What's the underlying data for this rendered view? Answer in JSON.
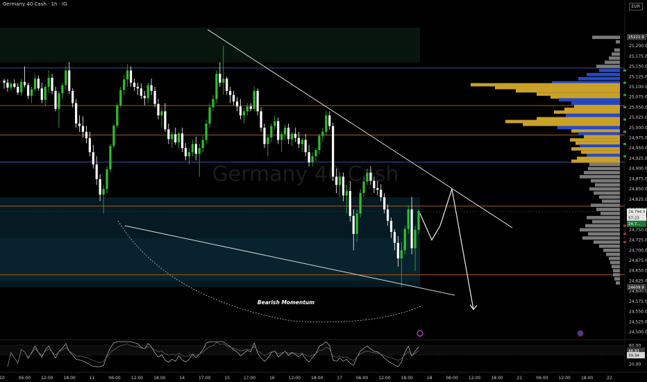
{
  "header": {
    "title": "Germany 40 Cash · 1h · IG",
    "currency": "EUR"
  },
  "watermark": "Germany 40 Cash",
  "annotation": "Bearish Momentum",
  "price_tags": {
    "top": "25221.9",
    "bottom": "24609.9",
    "last": "24,794.5",
    "countdown": "57:23",
    "ema": "24,7..."
  },
  "osc_tags": {
    "upper": "48.93",
    "lower": "39.34"
  },
  "colors": {
    "bg": "#000000",
    "up": "#2fbf2f",
    "down": "#ffffff",
    "line_blue": "#3b4fa8",
    "line_orange": "#a85a1d",
    "vp_gold": "#c9a028",
    "vp_blue": "#2549c8",
    "vp_gray": "#7a7a7a",
    "zone_green": "#0b1e14",
    "zone_teal": "#06202a"
  },
  "chart_data": {
    "type": "candlestick",
    "ylim": [
      24500,
      25275
    ],
    "y_ticks": [
      "25,225.0",
      "25,200.0",
      "25,175.0",
      "25,150.0",
      "25,125.0",
      "25,100.0",
      "25,075.0",
      "25,050.0",
      "25,025.0",
      "25,000.0",
      "24,975.0",
      "24,950.0",
      "24,925.0",
      "24,900.0",
      "24,875.0",
      "24,850.0",
      "24,825.0",
      "24,800.0",
      "24,775.0",
      "24,750.0",
      "24,725.0",
      "24,700.0",
      "24,675.0",
      "24,650.0",
      "24,625.0",
      "24,600.0",
      "24,575.0",
      "24,550.0",
      "24,525.0",
      "24,500.0"
    ],
    "x_ticks": [
      "10",
      "06:00",
      "12:00",
      "18:00",
      "11",
      "06:00",
      "12:00",
      "18:00",
      "14",
      "17:00",
      "15",
      "17:00",
      "16",
      "12:00",
      "18:00",
      "17",
      "06:00",
      "12:00",
      "18:00",
      "18",
      "06:00",
      "12:00",
      "18:00",
      "21",
      "06:00",
      "12:00",
      "18:00",
      "22"
    ],
    "osc_ticks": [
      "60.00",
      "40.00",
      "20.00"
    ],
    "osc_ylim": [
      15,
      68
    ],
    "h_levels": [
      {
        "price": 25146,
        "color": "line_blue"
      },
      {
        "price": 25054,
        "color": "line_orange"
      },
      {
        "price": 24982,
        "color": "line_orange"
      },
      {
        "price": 24916,
        "color": "line_blue"
      },
      {
        "price": 24808,
        "color": "line_orange"
      },
      {
        "price": 24640,
        "color": "line_orange"
      }
    ],
    "candles": [
      [
        25115,
        25120,
        25095,
        25110
      ],
      [
        25110,
        25118,
        25088,
        25098
      ],
      [
        25098,
        25112,
        25090,
        25108
      ],
      [
        25108,
        25118,
        25096,
        25100
      ],
      [
        25100,
        25108,
        25080,
        25086
      ],
      [
        25086,
        25120,
        25078,
        25112
      ],
      [
        25112,
        25150,
        25098,
        25104
      ],
      [
        25104,
        25110,
        25070,
        25078
      ],
      [
        25078,
        25100,
        25060,
        25094
      ],
      [
        25094,
        25130,
        25088,
        25120
      ],
      [
        25120,
        25128,
        25090,
        25096
      ],
      [
        25096,
        25110,
        25060,
        25068
      ],
      [
        25068,
        25105,
        25052,
        25100
      ],
      [
        25100,
        25140,
        25085,
        25122
      ],
      [
        25122,
        25132,
        25082,
        25090
      ],
      [
        25090,
        25100,
        25040,
        25046
      ],
      [
        25046,
        25090,
        25000,
        25084
      ],
      [
        25084,
        25110,
        25070,
        25104
      ],
      [
        25104,
        25150,
        25092,
        25140
      ],
      [
        25140,
        25160,
        25082,
        25090
      ],
      [
        25090,
        25096,
        25050,
        25060
      ],
      [
        25060,
        25070,
        25000,
        25010
      ],
      [
        25010,
        25030,
        24990,
        25004
      ],
      [
        25004,
        25028,
        24975,
        24990
      ],
      [
        24990,
        25004,
        24962,
        24974
      ],
      [
        24974,
        24990,
        24930,
        24940
      ],
      [
        24940,
        24958,
        24900,
        24910
      ],
      [
        24910,
        24930,
        24860,
        24874
      ],
      [
        24874,
        24886,
        24820,
        24836
      ],
      [
        24836,
        24860,
        24790,
        24850
      ],
      [
        24850,
        24905,
        24840,
        24898
      ],
      [
        24898,
        24960,
        24890,
        24955
      ],
      [
        24955,
        25010,
        24950,
        25005
      ],
      [
        25005,
        25060,
        25000,
        25055
      ],
      [
        25055,
        25100,
        25050,
        25092
      ],
      [
        25092,
        25130,
        25080,
        25118
      ],
      [
        25118,
        25155,
        25100,
        25140
      ],
      [
        25140,
        25150,
        25100,
        25110
      ],
      [
        25110,
        25120,
        25090,
        25100
      ],
      [
        25100,
        25110,
        25080,
        25096
      ],
      [
        25096,
        25108,
        25070,
        25078
      ],
      [
        25078,
        25090,
        25055,
        25072
      ],
      [
        25072,
        25110,
        25060,
        25104
      ],
      [
        25104,
        25120,
        25080,
        25090
      ],
      [
        25090,
        25100,
        25050,
        25058
      ],
      [
        25058,
        25070,
        25020,
        25030
      ],
      [
        25030,
        25050,
        25000,
        25040
      ],
      [
        25040,
        25060,
        24990,
        24996
      ],
      [
        24996,
        25010,
        24960,
        24972
      ],
      [
        24972,
        24990,
        24950,
        24984
      ],
      [
        24984,
        25000,
        24958,
        24964
      ],
      [
        24964,
        24990,
        24950,
        24986
      ],
      [
        24986,
        25000,
        24940,
        24950
      ],
      [
        24950,
        24962,
        24920,
        24930
      ],
      [
        24930,
        24950,
        24910,
        24940
      ],
      [
        24940,
        24970,
        24930,
        24960
      ],
      [
        24960,
        24978,
        24920,
        24936
      ],
      [
        24936,
        24960,
        24880,
        24950
      ],
      [
        24950,
        24980,
        24940,
        24970
      ],
      [
        24970,
        25020,
        24960,
        25010
      ],
      [
        25010,
        25060,
        25000,
        25050
      ],
      [
        25050,
        25080,
        25040,
        25070
      ],
      [
        25070,
        25140,
        25060,
        25132
      ],
      [
        25132,
        25160,
        25100,
        25110
      ],
      [
        25110,
        25200,
        25080,
        25120
      ],
      [
        25120,
        25125,
        25080,
        25090
      ],
      [
        25090,
        25100,
        25060,
        25080
      ],
      [
        25080,
        25090,
        25055,
        25064
      ],
      [
        25064,
        25075,
        25040,
        25052
      ],
      [
        25052,
        25070,
        25020,
        25030
      ],
      [
        25030,
        25048,
        25010,
        25040
      ],
      [
        25040,
        25060,
        25030,
        25052
      ],
      [
        25052,
        25060,
        25040,
        25046
      ],
      [
        25046,
        25100,
        25040,
        25090
      ],
      [
        25090,
        25096,
        25030,
        25040
      ],
      [
        25040,
        25050,
        24990,
        25000
      ],
      [
        25000,
        25010,
        24950,
        24960
      ],
      [
        24960,
        24980,
        24930,
        24976
      ],
      [
        24976,
        25010,
        24965,
        25004
      ],
      [
        25004,
        25030,
        24995,
        25016
      ],
      [
        25016,
        25025,
        24960,
        24970
      ],
      [
        24970,
        24990,
        24940,
        24984
      ],
      [
        24984,
        25008,
        24970,
        25000
      ],
      [
        25000,
        25010,
        24960,
        24972
      ],
      [
        24972,
        24990,
        24955,
        24985
      ],
      [
        24985,
        25000,
        24965,
        24975
      ],
      [
        24975,
        24990,
        24950,
        24960
      ],
      [
        24960,
        24975,
        24940,
        24970
      ],
      [
        24970,
        24985,
        24930,
        24940
      ],
      [
        24940,
        24958,
        24905,
        24915
      ],
      [
        24915,
        24940,
        24905,
        24930
      ],
      [
        24930,
        24950,
        24918,
        24945
      ],
      [
        24945,
        24985,
        24935,
        24980
      ],
      [
        24980,
        25000,
        24965,
        24990
      ],
      [
        24990,
        25040,
        24980,
        25030
      ],
      [
        25030,
        25040,
        24995,
        25004
      ],
      [
        25004,
        25012,
        24870,
        24880
      ],
      [
        24880,
        24900,
        24840,
        24860
      ],
      [
        24860,
        24890,
        24830,
        24880
      ],
      [
        24880,
        24890,
        24820,
        24834
      ],
      [
        24834,
        24860,
        24790,
        24845
      ],
      [
        24845,
        24870,
        24770,
        24784
      ],
      [
        24784,
        24800,
        24700,
        24740
      ],
      [
        24740,
        24800,
        24720,
        24790
      ],
      [
        24790,
        24850,
        24780,
        24840
      ],
      [
        24840,
        24880,
        24830,
        24868
      ],
      [
        24868,
        24900,
        24860,
        24890
      ],
      [
        24890,
        24905,
        24860,
        24870
      ],
      [
        24870,
        24880,
        24840,
        24852
      ],
      [
        24852,
        24870,
        24835,
        24848
      ],
      [
        24848,
        24862,
        24820,
        24830
      ],
      [
        24830,
        24840,
        24790,
        24800
      ],
      [
        24800,
        24812,
        24760,
        24772
      ],
      [
        24772,
        24780,
        24730,
        24745
      ],
      [
        24745,
        24752,
        24700,
        24718
      ],
      [
        24718,
        24735,
        24660,
        24680
      ],
      [
        24680,
        24720,
        24610,
        24700
      ],
      [
        24700,
        24760,
        24690,
        24752
      ],
      [
        24752,
        24810,
        24740,
        24800
      ],
      [
        24800,
        24830,
        24690,
        24705
      ],
      [
        24705,
        24760,
        24650,
        24750
      ],
      [
        24750,
        24800,
        24740,
        24796
      ]
    ],
    "volume_profile": [
      [
        25221,
        40,
        "vp_gray"
      ],
      [
        25210,
        6,
        "vp_gray"
      ],
      [
        25190,
        8,
        "vp_gray"
      ],
      [
        25180,
        12,
        "vp_gray"
      ],
      [
        25170,
        16,
        "vp_gray"
      ],
      [
        25160,
        22,
        "vp_gray"
      ],
      [
        25150,
        34,
        "vp_gray"
      ],
      [
        25140,
        30,
        "vp_blue"
      ],
      [
        25130,
        48,
        "vp_blue"
      ],
      [
        25120,
        60,
        "vp_blue"
      ],
      [
        25110,
        98,
        "vp_blue"
      ],
      [
        25105,
        215,
        "vp_gold"
      ],
      [
        25098,
        180,
        "vp_gold"
      ],
      [
        25090,
        150,
        "vp_gold"
      ],
      [
        25082,
        120,
        "vp_gold"
      ],
      [
        25075,
        100,
        "vp_gold"
      ],
      [
        25068,
        88,
        "vp_blue"
      ],
      [
        25060,
        70,
        "vp_blue"
      ],
      [
        25052,
        66,
        "vp_gold"
      ],
      [
        25045,
        80,
        "vp_gold"
      ],
      [
        25038,
        95,
        "vp_gold"
      ],
      [
        25030,
        78,
        "vp_blue"
      ],
      [
        25022,
        120,
        "vp_gold"
      ],
      [
        25015,
        165,
        "vp_gold"
      ],
      [
        25008,
        140,
        "vp_gold"
      ],
      [
        25000,
        90,
        "vp_blue"
      ],
      [
        24992,
        70,
        "vp_gold"
      ],
      [
        24985,
        60,
        "vp_blue"
      ],
      [
        24978,
        52,
        "vp_gold"
      ],
      [
        24970,
        72,
        "vp_gold"
      ],
      [
        24962,
        64,
        "vp_gold"
      ],
      [
        24955,
        58,
        "vp_blue"
      ],
      [
        24948,
        70,
        "vp_gold"
      ],
      [
        24940,
        56,
        "vp_gold"
      ],
      [
        24932,
        48,
        "vp_blue"
      ],
      [
        24925,
        62,
        "vp_gold"
      ],
      [
        24918,
        70,
        "vp_gold"
      ],
      [
        24910,
        44,
        "vp_gray"
      ],
      [
        24900,
        46,
        "vp_gray"
      ],
      [
        24890,
        52,
        "vp_gray"
      ],
      [
        24880,
        58,
        "vp_gray"
      ],
      [
        24870,
        42,
        "vp_gray"
      ],
      [
        24860,
        36,
        "vp_gray"
      ],
      [
        24850,
        44,
        "vp_gray"
      ],
      [
        24840,
        38,
        "vp_gray"
      ],
      [
        24830,
        30,
        "vp_gray"
      ],
      [
        24820,
        26,
        "vp_gray"
      ],
      [
        24810,
        42,
        "vp_gray"
      ],
      [
        24800,
        34,
        "vp_gray"
      ],
      [
        24790,
        28,
        "vp_gray"
      ],
      [
        24780,
        48,
        "vp_gray"
      ],
      [
        24770,
        40,
        "vp_gray"
      ],
      [
        24760,
        50,
        "vp_gray"
      ],
      [
        24750,
        58,
        "vp_gray"
      ],
      [
        24740,
        46,
        "vp_gray"
      ],
      [
        24730,
        54,
        "vp_gray"
      ],
      [
        24720,
        38,
        "vp_gray"
      ],
      [
        24710,
        30,
        "vp_gray"
      ],
      [
        24700,
        24,
        "vp_gray"
      ],
      [
        24690,
        20,
        "vp_gray"
      ],
      [
        24680,
        16,
        "vp_gray"
      ],
      [
        24670,
        14,
        "vp_gray"
      ],
      [
        24660,
        12,
        "vp_gray"
      ],
      [
        24650,
        10,
        "vp_gray"
      ],
      [
        24640,
        10,
        "vp_gray"
      ],
      [
        24630,
        8,
        "vp_gray"
      ],
      [
        24620,
        6,
        "vp_gray"
      ]
    ],
    "trendlines": [
      {
        "p1": [
          299,
          25240
        ],
        "p2": [
          738,
          24755
        ],
        "stroke": "#d9d9d9"
      },
      {
        "p1": [
          180,
          24760
        ],
        "p2": [
          655,
          24590
        ],
        "stroke": "#d9d9d9"
      }
    ],
    "projection": [
      [
        605,
        24790
      ],
      [
        622,
        24725
      ],
      [
        634,
        24760
      ],
      [
        651,
        24850
      ],
      [
        682,
        24555
      ]
    ]
  }
}
